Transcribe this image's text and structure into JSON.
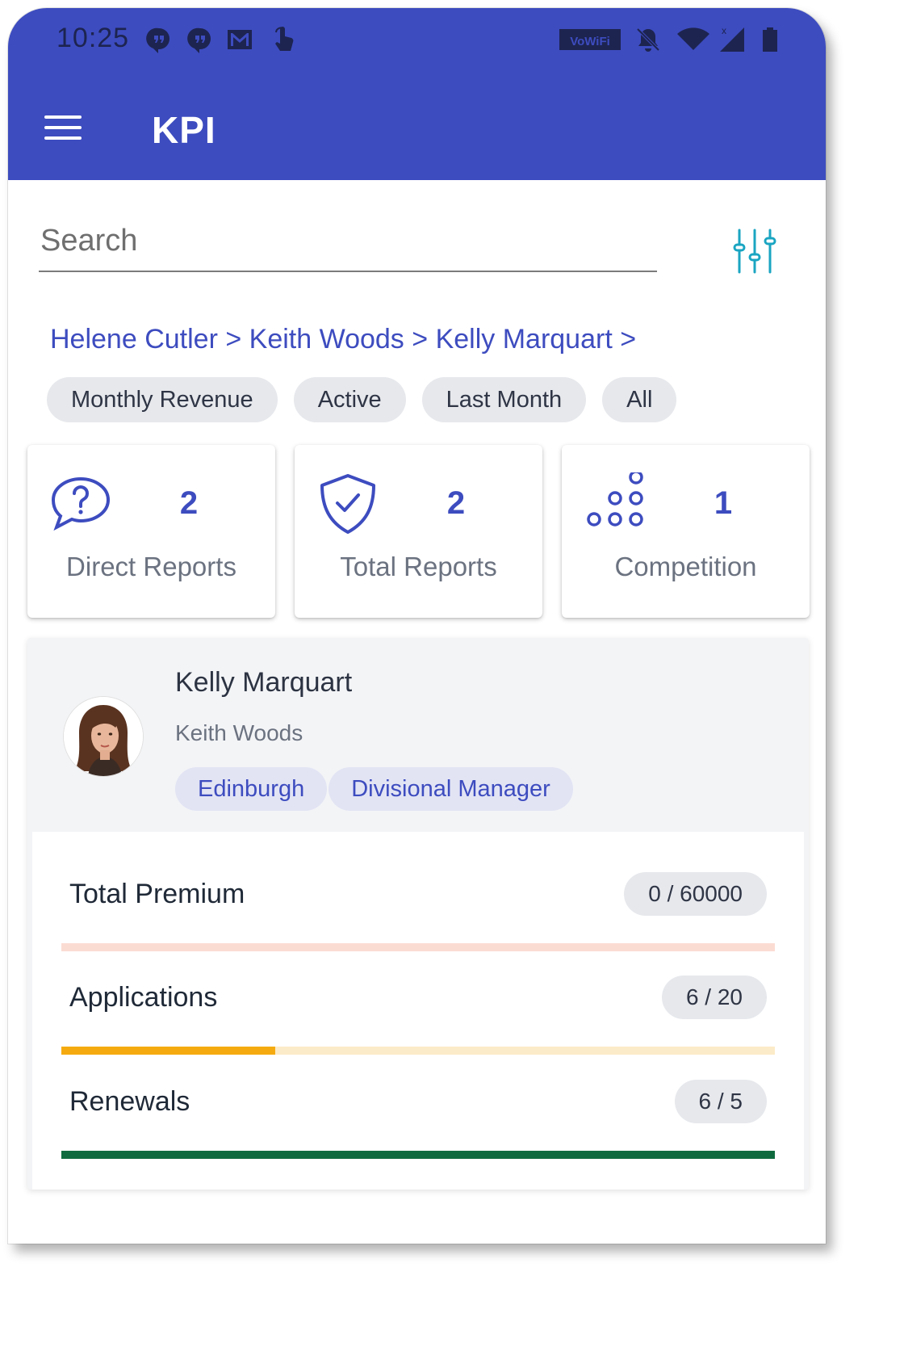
{
  "status_bar": {
    "time": "10:25",
    "left_icons": [
      "quote-notification-icon",
      "quote-notification-icon",
      "gmail-icon",
      "touch-icon"
    ],
    "right_icons": [
      "vowifi-icon",
      "bell-off-icon",
      "wifi-icon",
      "signal-icon",
      "battery-icon"
    ],
    "vowifi_label": "Vo WiFi"
  },
  "app_bar": {
    "title": "KPI",
    "menu_icon": "hamburger-menu-icon",
    "color": "#3d4cbf"
  },
  "search": {
    "placeholder": "Search",
    "value": "",
    "filter_icon": "sliders-icon"
  },
  "breadcrumb": {
    "items": [
      "Helene Cutler",
      "Keith Woods",
      "Kelly Marquart"
    ],
    "separator": ">"
  },
  "filter_chips": [
    "Monthly Revenue",
    "Active",
    "Last Month",
    "All"
  ],
  "kpi_cards": [
    {
      "icon": "question-bubble-icon",
      "value": "2",
      "label": "Direct Reports"
    },
    {
      "icon": "shield-check-icon",
      "value": "2",
      "label": "Total Reports"
    },
    {
      "icon": "circles-pyramid-icon",
      "value": "1",
      "label": "Competition"
    }
  ],
  "profile": {
    "name": "Kelly Marquart",
    "manager": "Keith Woods",
    "tags": [
      "Edinburgh",
      "Divisional Manager"
    ],
    "avatar": "avatar-photo"
  },
  "metrics": [
    {
      "label": "Total Premium",
      "value_text": "0 / 60000",
      "progress": 0.0,
      "fill_color": "#f2a391",
      "track_color": "#fbdcd3"
    },
    {
      "label": "Applications",
      "value_text": "6 / 20",
      "progress": 0.3,
      "fill_color": "#f5ab0f",
      "track_color": "#fcebc8"
    },
    {
      "label": "Renewals",
      "value_text": "6 / 5",
      "progress": 1.0,
      "fill_color": "#0f6b3e",
      "track_color": "#cfe3d6"
    }
  ]
}
